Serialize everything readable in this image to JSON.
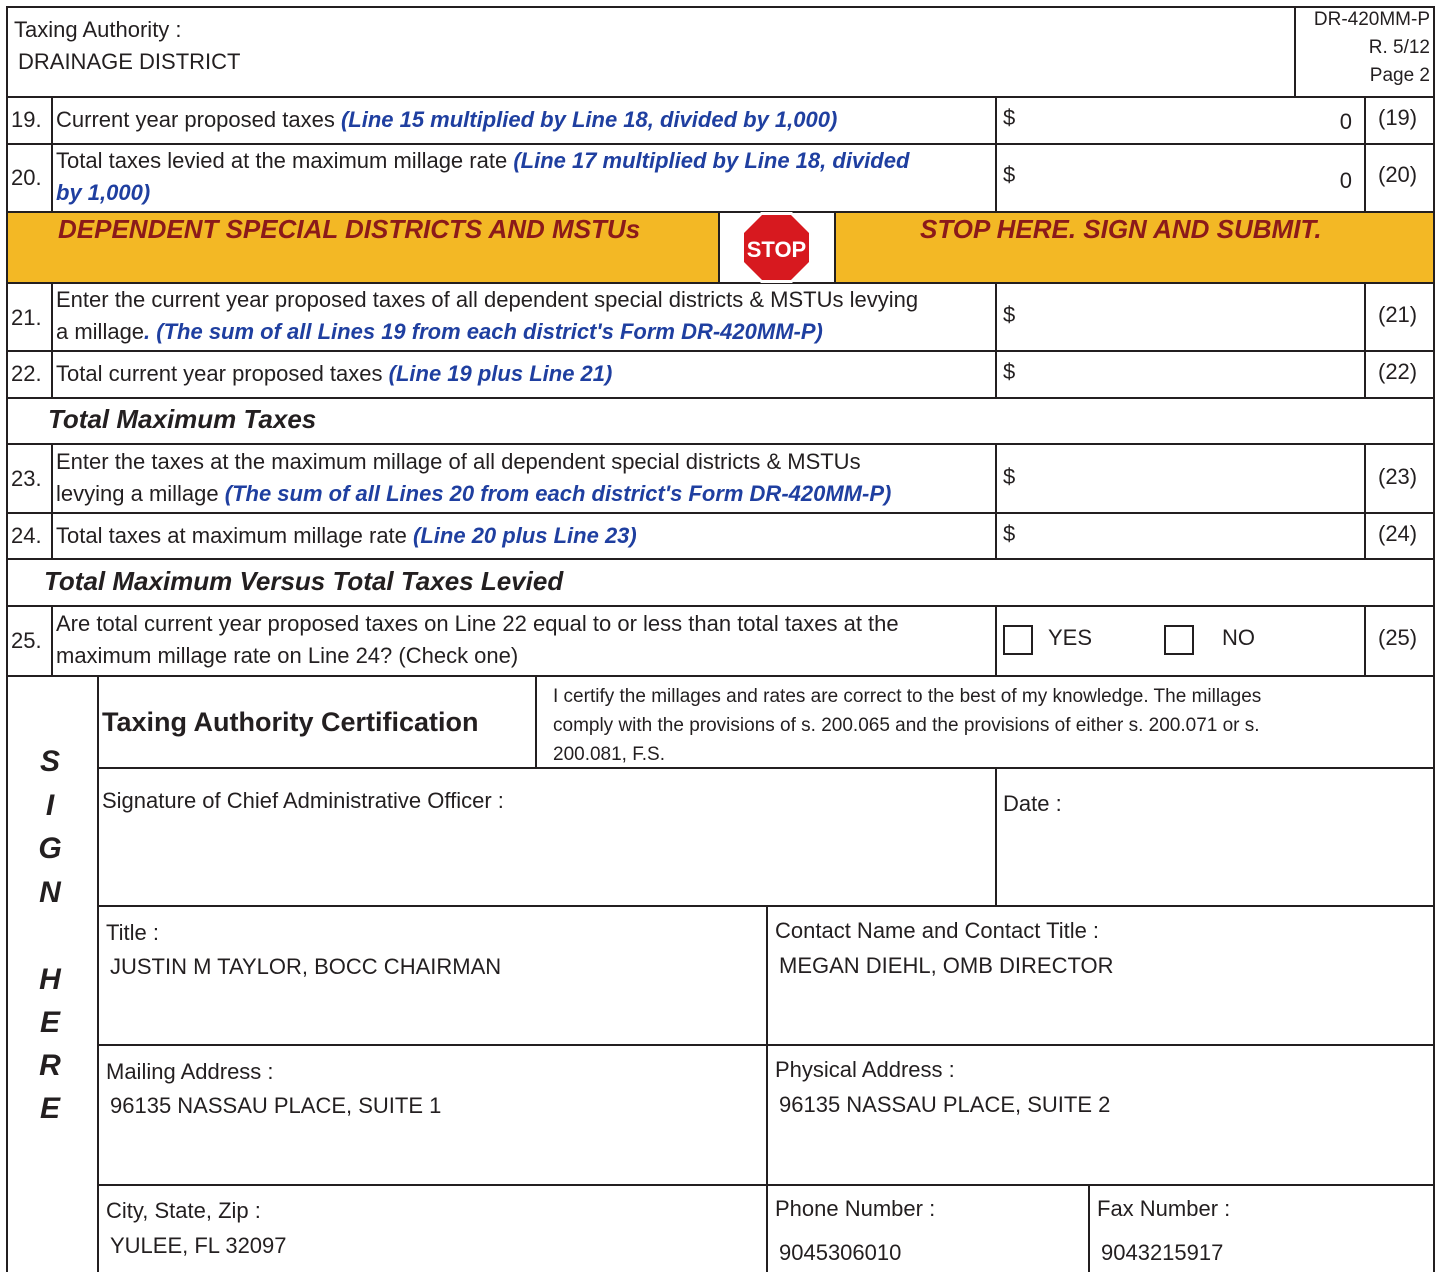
{
  "header": {
    "authority_label": "Taxing Authority :",
    "authority_value": "DRAINAGE DISTRICT",
    "form_id": "DR-420MM-P",
    "revision": "R. 5/12",
    "page": "Page 2"
  },
  "lines": {
    "l19": {
      "num": "19.",
      "text": "Current year proposed taxes ",
      "note": "(Line 15 multiplied by Line 18, divided by 1,000)",
      "dollar": "$",
      "value": "0",
      "ref": "(19)"
    },
    "l20": {
      "num": "20.",
      "text1": "Total taxes levied at the maximum millage rate ",
      "note1": "(Line 17 multiplied by Line 18, divided",
      "note2": "by 1,000)",
      "dollar": "$",
      "value": "0",
      "ref": "(20)"
    },
    "l21": {
      "num": "21.",
      "text1": "Enter the current year proposed taxes of all dependent special districts & MSTUs levying",
      "text2": "a millage",
      "note": ". (The sum of all Lines 19 from each district's Form DR-420MM-P)",
      "dollar": "$",
      "ref": "(21)"
    },
    "l22": {
      "num": "22.",
      "text": "Total current year proposed taxes ",
      "note": "(Line 19 plus Line 21)",
      "dollar": "$",
      "ref": "(22)"
    },
    "l23": {
      "num": "23.",
      "text1": "Enter the taxes at the maximum millage of all dependent special districts & MSTUs",
      "text2": "levying a millage ",
      "note": "(The sum of all Lines 20 from each district's Form DR-420MM-P)",
      "dollar": "$",
      "ref": "(23)"
    },
    "l24": {
      "num": "24.",
      "text": "Total taxes at maximum millage rate ",
      "note": "(Line 20 plus Line 23)",
      "dollar": "$",
      "ref": "(24)"
    },
    "l25": {
      "num": "25.",
      "text1": "Are total current year proposed taxes on Line 22 equal to or less than total taxes at the",
      "text2": "maximum millage rate on Line 24? (Check one)",
      "yes": "YES",
      "no": "NO",
      "ref": "(25)"
    }
  },
  "band": {
    "left": "DEPENDENT SPECIAL  DISTRICTS AND MSTUs",
    "stop": "STOP",
    "right": "STOP HERE. SIGN AND SUBMIT.",
    "color": "#f3b825",
    "text_color": "#8b1a1a"
  },
  "sections": {
    "total_max": "Total Maximum Taxes",
    "total_vs": "Total Maximum Versus Total Taxes Levied"
  },
  "sign": {
    "letters1": [
      "S",
      "I",
      "G",
      "N"
    ],
    "letters2": [
      "H",
      "E",
      "R",
      "E"
    ],
    "cert_title": "Taxing Authority Certification",
    "cert_text1": "I certify the millages and rates are correct to the best of my knowledge. The millages",
    "cert_text2": "comply with the provisions of s. 200.065 and the provisions of either s. 200.071 or s.",
    "cert_text3": "200.081, F.S.",
    "signature_label": "Signature of Chief Administrative Officer :",
    "date_label": "Date :",
    "title_label": "Title :",
    "title_value": "JUSTIN M TAYLOR, BOCC CHAIRMAN",
    "contact_label": "Contact Name and Contact Title :",
    "contact_value": "MEGAN DIEHL, OMB DIRECTOR",
    "mailing_label": "Mailing Address :",
    "mailing_value": "96135 NASSAU PLACE, SUITE 1",
    "physical_label": "Physical Address :",
    "physical_value": "96135 NASSAU PLACE, SUITE 2",
    "city_label": "City, State, Zip :",
    "city_value": "YULEE, FL 32097",
    "phone_label": "Phone Number :",
    "phone_value": "9045306010",
    "fax_label": "Fax Number :",
    "fax_value": "9043215917"
  },
  "colors": {
    "note_blue": "#1f3fa0",
    "stop_red": "#d7191f"
  }
}
